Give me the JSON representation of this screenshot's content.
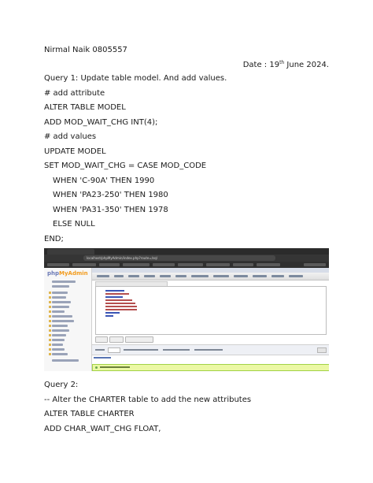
{
  "header": {
    "author_line": "Nirmal Naik 0805557",
    "date_prefix": "Date : 19",
    "date_suffix": "th",
    "date_rest": " June 2024."
  },
  "query1": {
    "title": "Query 1: Update table model. And add values.",
    "lines": [
      "# add attribute",
      "ALTER TABLE MODEL",
      "ADD MOD_WAIT_CHG INT(4);",
      "# add values",
      "UPDATE MODEL",
      "SET MOD_WAIT_CHG = CASE MOD_CODE",
      "WHEN 'C-90A' THEN 1990",
      "WHEN 'PA23-250' THEN 1980",
      "WHEN 'PA31-350' THEN 1978",
      "ELSE NULL",
      "END;"
    ]
  },
  "screenshot": {
    "logo_php": "php",
    "logo_myadmin": "MyAdmin",
    "url_text": "localhost/phpMyAdmin/index.php?route=/sql"
  },
  "query2": {
    "title": "Query 2:",
    "lines": [
      "-- Alter the CHARTER table to add the new attributes",
      "ALTER TABLE CHARTER",
      "ADD CHAR_WAIT_CHG FLOAT,"
    ]
  }
}
